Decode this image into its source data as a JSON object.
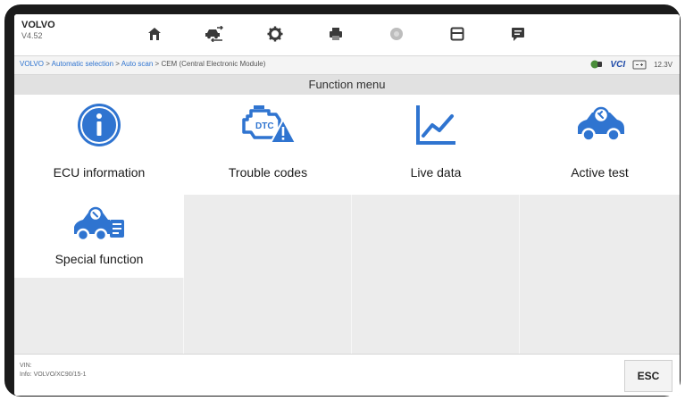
{
  "app": {
    "brand": "VOLVO",
    "version": "V4.52"
  },
  "toolbar": {
    "icons": [
      "home-icon",
      "vehicle-swap-icon",
      "settings-icon",
      "print-icon",
      "help-icon",
      "save-icon",
      "data-log-icon"
    ]
  },
  "breadcrumb": {
    "links": [
      "VOLVO",
      "Automatic selection",
      "Auto scan"
    ],
    "separator": " > ",
    "current": "CEM (Central Electronic Module)"
  },
  "status": {
    "vci": "VCI",
    "voltage": "12.3V"
  },
  "menu": {
    "title": "Function menu",
    "items": [
      {
        "label": "ECU information",
        "icon": "info-icon"
      },
      {
        "label": "Trouble codes",
        "icon": "engine-warning-icon"
      },
      {
        "label": "Live data",
        "icon": "line-chart-icon"
      },
      {
        "label": "Active test",
        "icon": "car-active-test-icon"
      },
      {
        "label": "Special function",
        "icon": "car-special-function-icon"
      }
    ]
  },
  "footer": {
    "vin_label": "VIN:",
    "info": "Info: VOLVO/XC90/15-1",
    "esc_label": "ESC"
  },
  "colors": {
    "accent": "#2f74d0",
    "tile": "#ffffff",
    "panel": "#ececec",
    "title_bar": "#e1e1e1"
  }
}
